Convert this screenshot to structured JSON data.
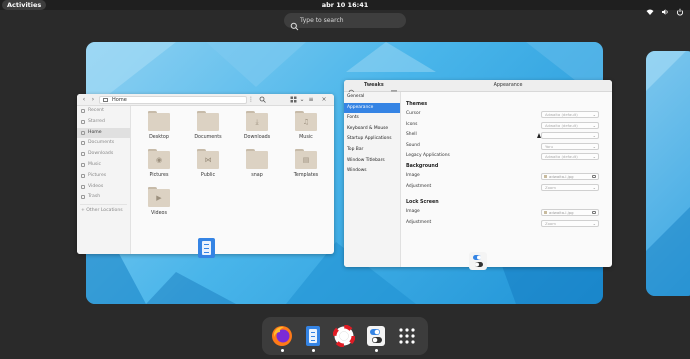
{
  "topbar": {
    "activities_label": "Activities",
    "clock": "abr 10  16:41",
    "tray_icons": [
      "network-icon",
      "volume-icon",
      "power-icon"
    ]
  },
  "search": {
    "placeholder": "Type to search"
  },
  "files_window": {
    "path": "Home",
    "sidebar": [
      {
        "label": "Recent",
        "icon": "clock-icon"
      },
      {
        "label": "Starred",
        "icon": "star-icon"
      },
      {
        "label": "Home",
        "icon": "home-icon",
        "active": true
      },
      {
        "label": "Documents",
        "icon": "document-icon"
      },
      {
        "label": "Downloads",
        "icon": "download-icon"
      },
      {
        "label": "Music",
        "icon": "music-icon"
      },
      {
        "label": "Pictures",
        "icon": "picture-icon"
      },
      {
        "label": "Videos",
        "icon": "video-icon"
      },
      {
        "label": "Trash",
        "icon": "trash-icon"
      },
      {
        "label": "+ Other Locations",
        "icon": "plus-icon"
      }
    ],
    "folders": [
      {
        "label": "Desktop",
        "emblem": ""
      },
      {
        "label": "Documents",
        "emblem": ""
      },
      {
        "label": "Downloads",
        "emblem": "⤓"
      },
      {
        "label": "Music",
        "emblem": "♫"
      },
      {
        "label": "Pictures",
        "emblem": "◉"
      },
      {
        "label": "Public",
        "emblem": "⋈"
      },
      {
        "label": "snap",
        "emblem": ""
      },
      {
        "label": "Templates",
        "emblem": "▤"
      },
      {
        "label": "Videos",
        "emblem": "▶"
      }
    ]
  },
  "tweaks_window": {
    "app_title": "Tweaks",
    "page_title": "Appearance",
    "nav": [
      {
        "label": "General"
      },
      {
        "label": "Appearance",
        "active": true
      },
      {
        "label": "Fonts"
      },
      {
        "label": "Keyboard & Mouse"
      },
      {
        "label": "Startup Applications"
      },
      {
        "label": "Top Bar"
      },
      {
        "label": "Window Titlebars"
      },
      {
        "label": "Windows"
      }
    ],
    "themes": {
      "heading": "Themes",
      "rows": [
        {
          "label": "Cursor",
          "value": "Adwaita (default)"
        },
        {
          "label": "Icons",
          "value": "Adwaita (default)"
        },
        {
          "label": "Shell",
          "value": ""
        },
        {
          "label": "Sound",
          "value": "Yaru"
        },
        {
          "label": "Legacy Applications",
          "value": "Adwaita (default)"
        }
      ]
    },
    "background": {
      "heading": "Background",
      "image_label": "Image",
      "image_value": "adwaita-l.jpg",
      "adjust_label": "Adjustment",
      "adjust_value": "Zoom"
    },
    "lockscreen": {
      "heading": "Lock Screen",
      "image_label": "Image",
      "image_value": "adwaita-l.jpg",
      "adjust_label": "Adjustment",
      "adjust_value": "Zoom"
    }
  },
  "dock": {
    "apps": [
      {
        "name": "firefox-icon",
        "running": true
      },
      {
        "name": "files-icon",
        "running": true
      },
      {
        "name": "help-icon",
        "running": false
      },
      {
        "name": "tweaks-icon",
        "running": true
      },
      {
        "name": "app-grid-icon",
        "running": false
      }
    ]
  },
  "colors": {
    "accent": "#3584e4",
    "topbar": "#1f1f1f",
    "background": "#2a2a2a",
    "wallpaper_blue": "#3aa6e2"
  }
}
